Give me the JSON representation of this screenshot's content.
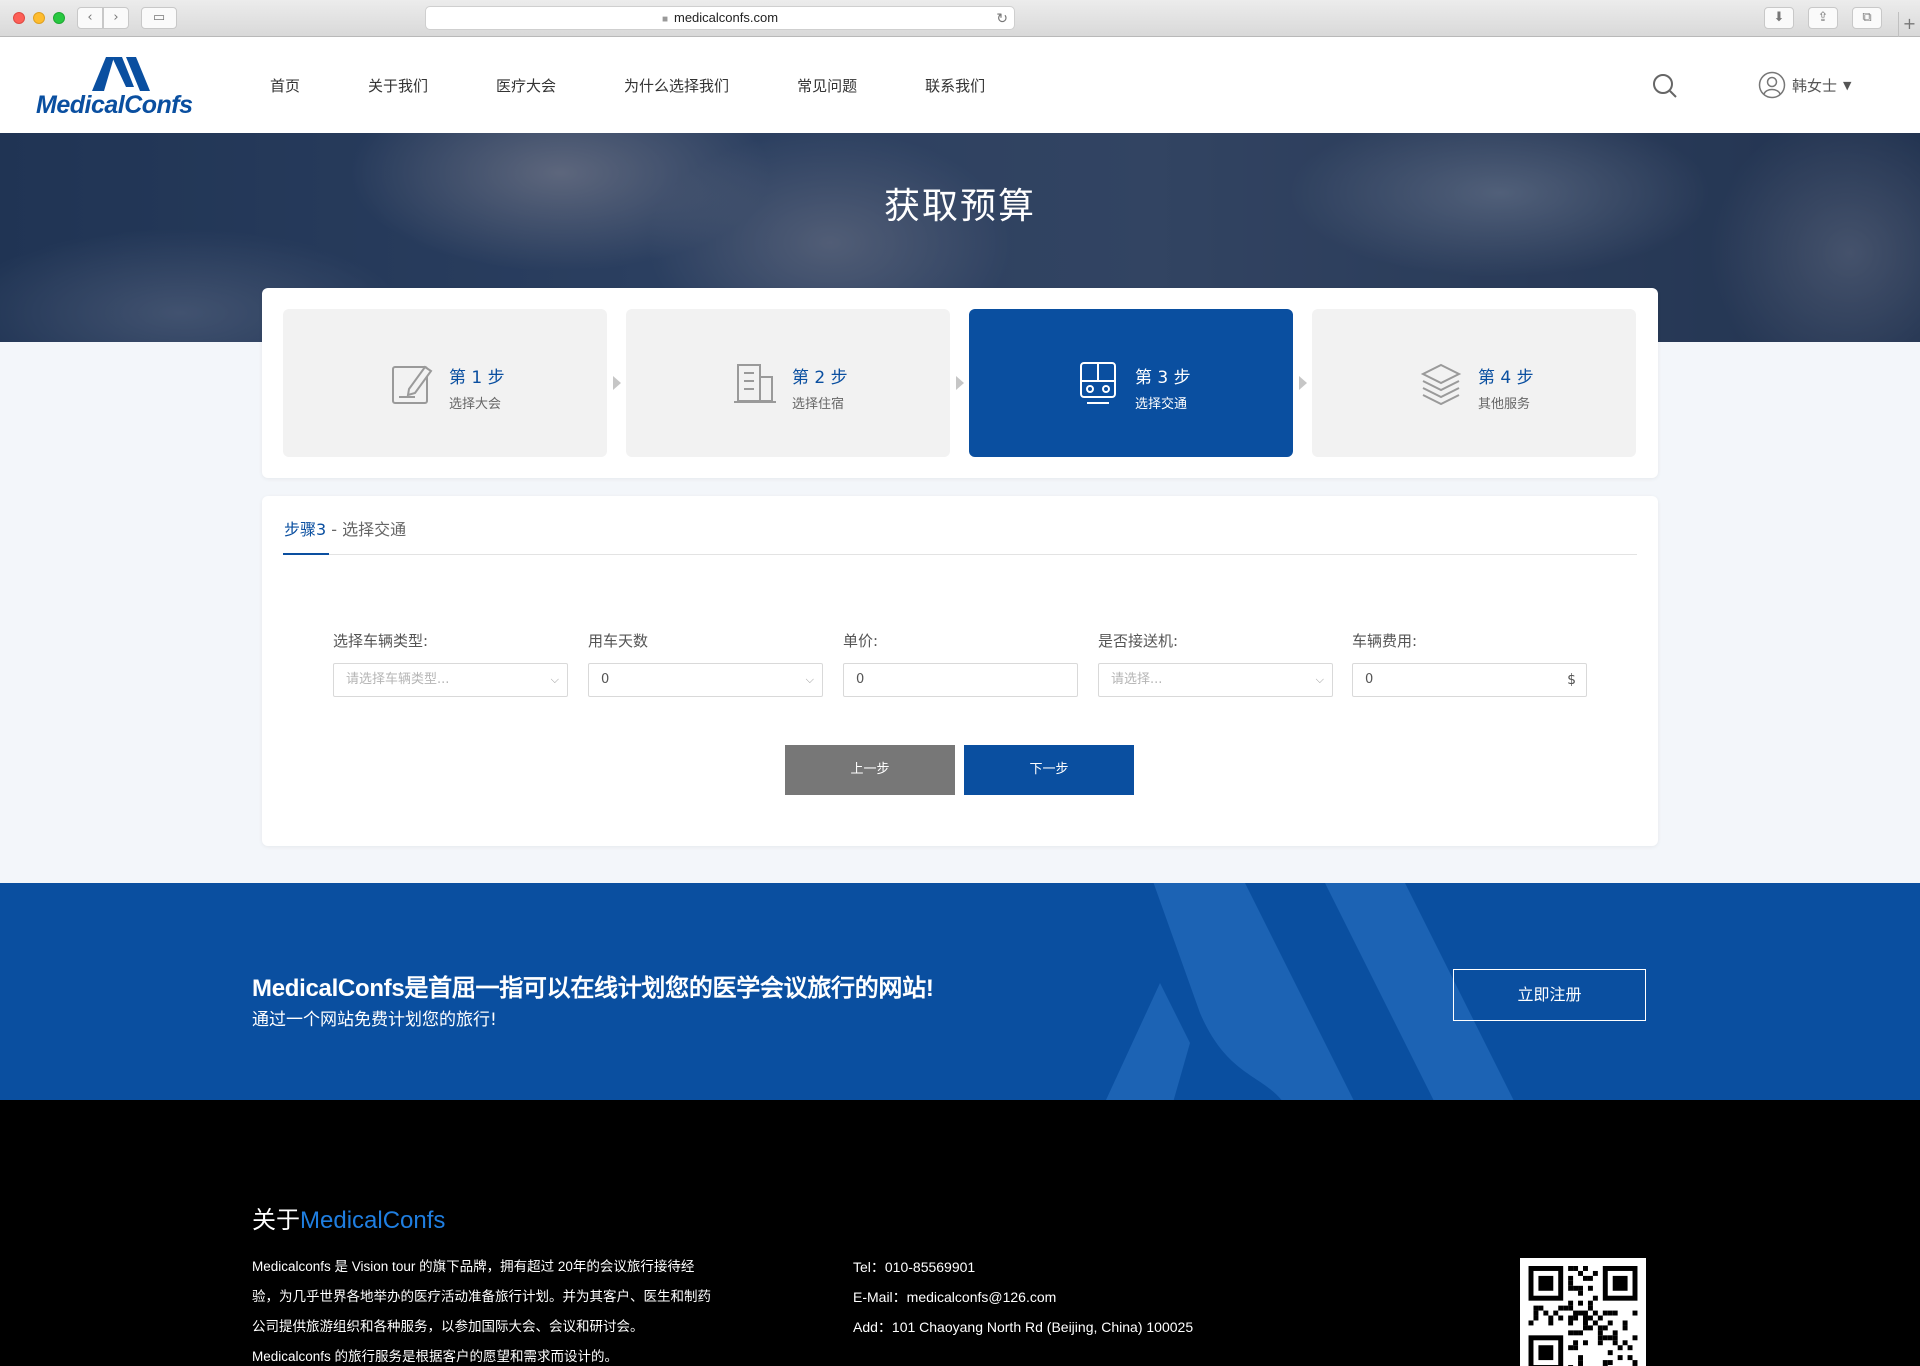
{
  "browser": {
    "url": "medicalconfs.com"
  },
  "header": {
    "logo_text": "MedicalConfs",
    "nav": [
      "首页",
      "关于我们",
      "医疗大会",
      "为什么选择我们",
      "常见问题",
      "联系我们"
    ],
    "user_name": "韩女士"
  },
  "hero": {
    "title": "获取预算"
  },
  "steps": [
    {
      "number": "第 1 步",
      "label": "选择大会",
      "icon": "edit-document-icon",
      "active": false
    },
    {
      "number": "第 2 步",
      "label": "选择住宿",
      "icon": "building-icon",
      "active": false
    },
    {
      "number": "第 3 步",
      "label": "选择交通",
      "icon": "train-icon",
      "active": true
    },
    {
      "number": "第 4 步",
      "label": "其他服务",
      "icon": "layers-icon",
      "active": false
    }
  ],
  "form": {
    "tab_prefix": "步骤3",
    "tab_suffix": " - 选择交通",
    "fields": [
      {
        "label": "选择车辆类型:",
        "placeholder": "请选择车辆类型...",
        "value": "",
        "type": "select"
      },
      {
        "label": "用车天数",
        "placeholder": "",
        "value": "0",
        "type": "select"
      },
      {
        "label": "单价:",
        "placeholder": "",
        "value": "0",
        "type": "input"
      },
      {
        "label": "是否接送机:",
        "placeholder": "请选择...",
        "value": "",
        "type": "select"
      },
      {
        "label": "车辆费用:",
        "placeholder": "",
        "value": "0",
        "type": "input",
        "unit": "$"
      }
    ],
    "prev_label": "上一步",
    "next_label": "下一步"
  },
  "cta": {
    "headline": "MedicalConfs是首屈一指可以在线计划您的医学会议旅行的网站!",
    "subline": "通过一个网站免费计划您的旅行!",
    "button": "立即注册"
  },
  "footer": {
    "title_prefix": "关于",
    "title_brand": "MedicalConfs",
    "about_lines": [
      "Medicalconfs 是 Vision tour 的旗下品牌，拥有超过 20年的会议旅行接待经",
      "验，为几乎世界各地举办的医疗活动准备旅行计划。并为其客户、医生和制药",
      "公司提供旅游组织和各种服务，以参加国际大会、会议和研讨会。",
      "Medicalconfs 的旅行服务是根据客户的愿望和需求而设计的。"
    ],
    "tel": "Tel：010-85569901",
    "email": "E-Mail：medicalconfs@126.com",
    "address": "Add：101 Chaoyang North Rd (Beijing, China) 100025"
  },
  "colors": {
    "brand": "#0a4fa0",
    "accent_link": "#1f7ee0"
  }
}
